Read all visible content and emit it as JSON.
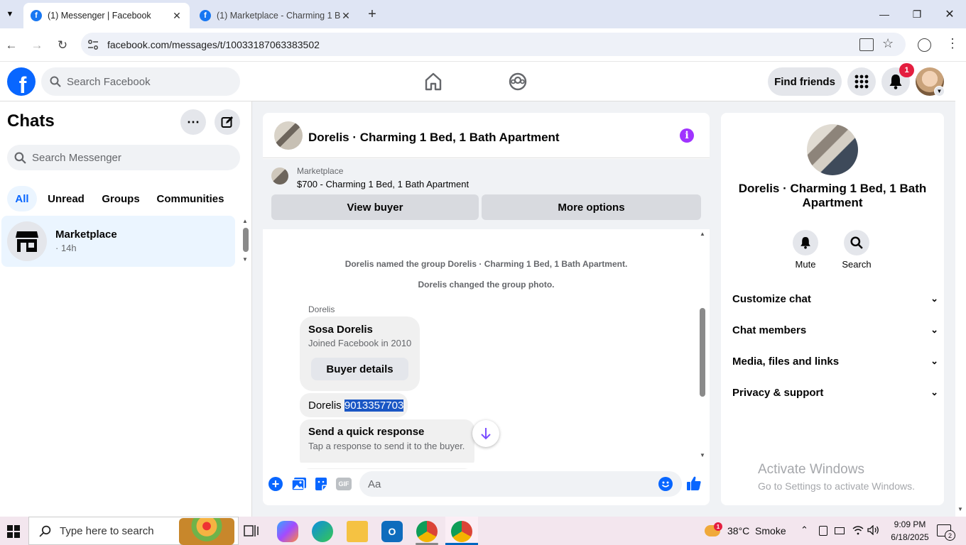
{
  "browser": {
    "tabs": [
      {
        "title": "(1) Messenger | Facebook",
        "active": true
      },
      {
        "title": "(1) Marketplace - Charming 1 B",
        "active": false
      }
    ],
    "url": "facebook.com/messages/t/10033187063383502"
  },
  "fb_header": {
    "search_placeholder": "Search Facebook",
    "find_friends_label": "Find friends",
    "notification_count": "1"
  },
  "sidebar": {
    "title": "Chats",
    "search_placeholder": "Search Messenger",
    "filters": [
      "All",
      "Unread",
      "Groups",
      "Communities"
    ],
    "selected_filter": "All",
    "chats": [
      {
        "name": "Marketplace",
        "time": "· 14h"
      }
    ]
  },
  "conversation": {
    "title": "Dorelis · Charming 1 Bed, 1 Bath Apartment",
    "marketplace_label": "Marketplace",
    "listing": "$700 - Charming 1 Bed, 1 Bath Apartment",
    "view_buyer_label": "View buyer",
    "more_options_label": "More options",
    "system_messages": [
      "Dorelis named the group Dorelis · Charming 1 Bed, 1 Bath Apartment.",
      "Dorelis changed the group photo."
    ],
    "sender": "Dorelis",
    "buyer_card": {
      "name": "Sosa Dorelis",
      "joined": "Joined Facebook in 2010",
      "button": "Buyer details"
    },
    "message_name": "Dorelis",
    "message_phone": "9013357703",
    "quick_response": {
      "title": "Send a quick response",
      "subtitle": "Tap a response to send it to the buyer."
    },
    "composer_placeholder": "Aa",
    "gif_label": "GIF"
  },
  "info_panel": {
    "title": "Dorelis · Charming 1 Bed, 1 Bath Apartment",
    "mute_label": "Mute",
    "search_label": "Search",
    "sections": [
      "Customize chat",
      "Chat members",
      "Media, files and links",
      "Privacy & support"
    ]
  },
  "watermark": {
    "title": "Activate Windows",
    "subtitle": "Go to Settings to activate Windows."
  },
  "taskbar": {
    "search_placeholder": "Type here to search",
    "weather": "38°C  Smoke",
    "time": "9:09 PM",
    "date": "6/18/2025",
    "notification_count": "2",
    "weather_badge": "1"
  },
  "colors": {
    "fb_blue": "#0866ff",
    "messenger_purple": "#a033ff",
    "badge_red": "#e41e3f",
    "selection_blue": "#1a56c4"
  }
}
